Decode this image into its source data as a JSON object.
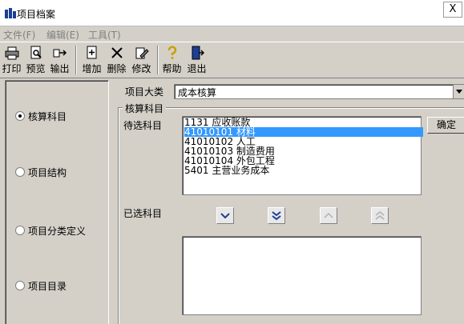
{
  "window": {
    "title": "项目档案",
    "close_label": "X"
  },
  "menu": [
    {
      "label": "文件(F)"
    },
    {
      "label": "编辑(E)"
    },
    {
      "label": "工具(T)"
    }
  ],
  "toolbar": {
    "print": "打印",
    "preview": "预览",
    "export": "输出",
    "add": "增加",
    "delete": "删除",
    "modify": "修改",
    "help": "帮助",
    "exit": "退出"
  },
  "sidebar": {
    "items": [
      {
        "label": "核算科目",
        "selected": true
      },
      {
        "label": "项目结构",
        "selected": false
      },
      {
        "label": "项目分类定义",
        "selected": false
      },
      {
        "label": "项目目录",
        "selected": false
      }
    ]
  },
  "main": {
    "category_label": "项目大类",
    "category_value": "成本核算",
    "group_title": "核算科目",
    "pending_label": "待选科目",
    "selected_label": "已选科目",
    "confirm_label": "确定",
    "pending_items": [
      {
        "text": "1131 应收账款",
        "selected": false
      },
      {
        "text": "41010101 材料",
        "selected": true
      },
      {
        "text": "41010102 人工",
        "selected": false
      },
      {
        "text": "41010103 制造费用",
        "selected": false
      },
      {
        "text": "41010104 外包工程",
        "selected": false
      },
      {
        "text": "5401 主营业务成本",
        "selected": false
      }
    ],
    "selected_items": []
  },
  "colors": {
    "selection": "#3399ff",
    "face": "#d4d0c8"
  }
}
